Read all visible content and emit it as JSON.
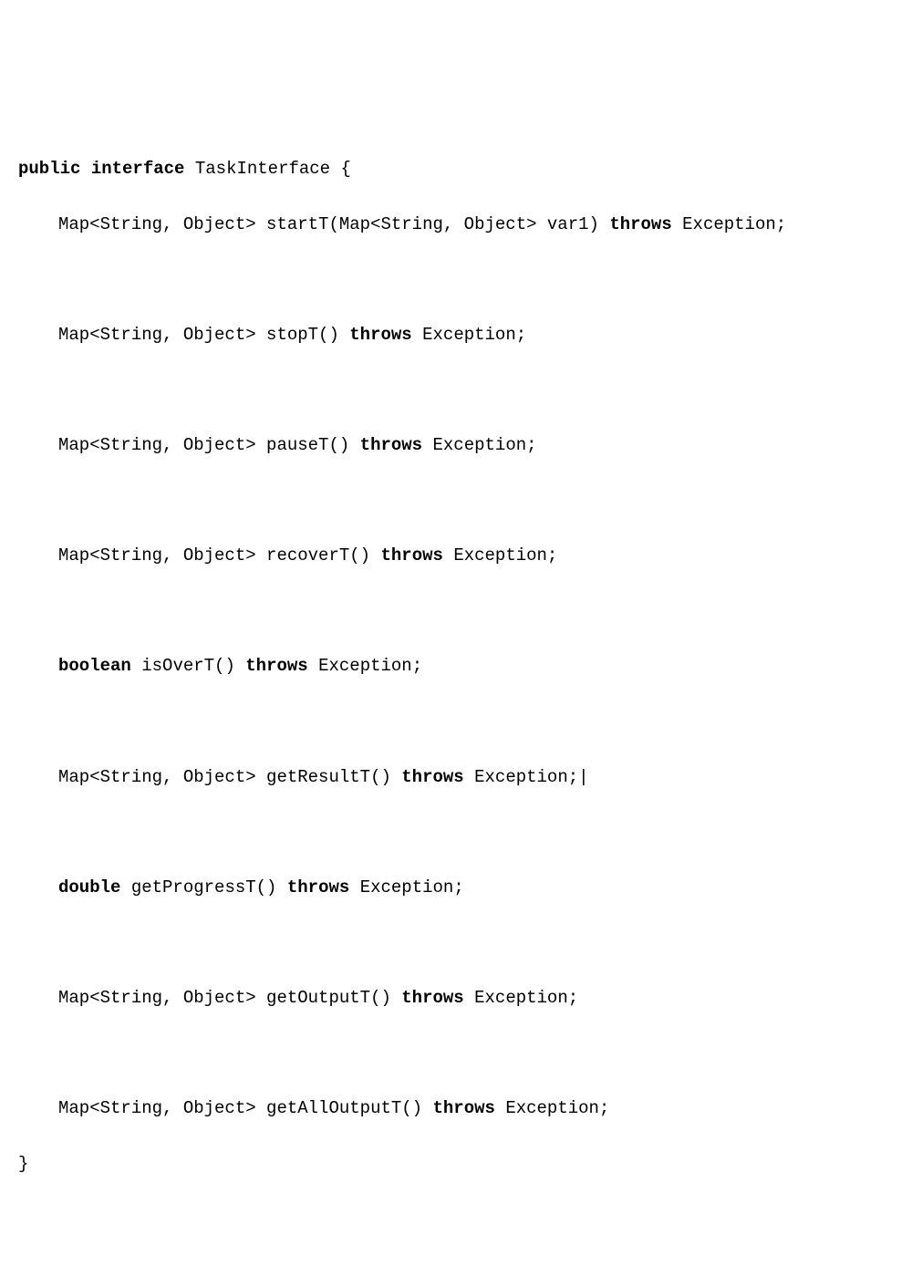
{
  "code": {
    "line1": {
      "kw1": "public",
      "kw2": "interface",
      "name": "TaskInterface",
      "brace": "{"
    },
    "line2": {
      "retType": "Map<String, Object>",
      "method": "startT(Map<String, Object> var1)",
      "kw": "throws",
      "exc": "Exception;"
    },
    "line3": {
      "retType": "Map<String, Object>",
      "method": "stopT()",
      "kw": "throws",
      "exc": "Exception;"
    },
    "line4": {
      "retType": "Map<String, Object>",
      "method": "pauseT()",
      "kw": "throws",
      "exc": "Exception;"
    },
    "line5": {
      "retType": "Map<String, Object>",
      "method": "recoverT()",
      "kw": "throws",
      "exc": "Exception;"
    },
    "line6": {
      "kwType": "boolean",
      "method": "isOverT()",
      "kw": "throws",
      "exc": "Exception;"
    },
    "line7": {
      "retType": "Map<String, Object>",
      "method": "getResultT()",
      "kw": "throws",
      "exc": "Exception;"
    },
    "line8": {
      "kwType": "double",
      "method": "getProgressT()",
      "kw": "throws",
      "exc": "Exception;"
    },
    "line9": {
      "retType": "Map<String, Object>",
      "method": "getOutputT()",
      "kw": "throws",
      "exc": "Exception;"
    },
    "line10": {
      "retType": "Map<String, Object>",
      "method": "getAllOutputT()",
      "kw": "throws",
      "exc": "Exception;"
    },
    "closeBrace": "}"
  }
}
